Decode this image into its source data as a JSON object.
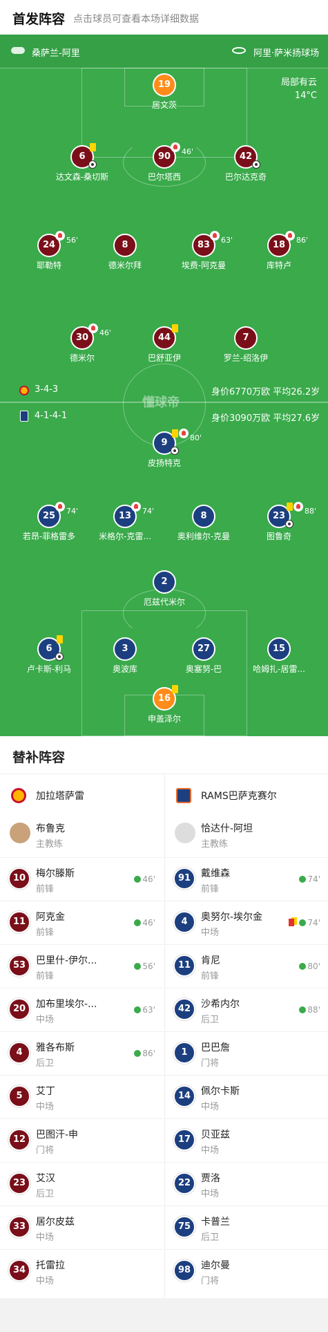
{
  "header": {
    "title": "首发阵容",
    "subtitle": "点击球员可查看本场详细数据"
  },
  "pitch": {
    "home_team_top": "桑萨兰-阿里",
    "venue": "阿里·萨米扬球场",
    "weather": "局部有云",
    "temperature": "14°C",
    "watermark": "懂球帝",
    "home_formation": "3-4-3",
    "home_value": "身价6770万欧 平均26.2岁",
    "away_formation": "4-1-4-1",
    "away_value": "身价3090万欧 平均27.6岁",
    "home_players": [
      {
        "num": "19",
        "name": "居文茨",
        "gk": true
      },
      {
        "num": "6",
        "name": "达文森-桑切斯"
      },
      {
        "num": "90",
        "name": "巴尔塔西",
        "sub": "46'"
      },
      {
        "num": "42",
        "name": "巴尔达克奇"
      },
      {
        "num": "24",
        "name": "耶勒特",
        "sub": "56'"
      },
      {
        "num": "8",
        "name": "德米尔拜"
      },
      {
        "num": "83",
        "name": "埃费-阿克曼",
        "sub": "63'"
      },
      {
        "num": "18",
        "name": "库特卢",
        "sub": "86'"
      },
      {
        "num": "30",
        "name": "德米尔",
        "sub": "46'"
      },
      {
        "num": "44",
        "name": "巴舒亚伊"
      },
      {
        "num": "7",
        "name": "罗兰-绍洛伊"
      }
    ],
    "away_players": [
      {
        "num": "9",
        "name": "皮扬特克",
        "sub": "80'"
      },
      {
        "num": "25",
        "name": "若昂-菲格雷多",
        "sub": "74'"
      },
      {
        "num": "13",
        "name": "米格尔-克雷...",
        "sub": "74'"
      },
      {
        "num": "8",
        "name": "奥利维尔-克曼"
      },
      {
        "num": "23",
        "name": "图鲁奇",
        "sub": "88'"
      },
      {
        "num": "2",
        "name": "厄兹代米尔"
      },
      {
        "num": "6",
        "name": "卢卡斯-利马"
      },
      {
        "num": "3",
        "name": "奥波库"
      },
      {
        "num": "27",
        "name": "奥塞努-巴"
      },
      {
        "num": "15",
        "name": "哈姆扎-居雷..."
      },
      {
        "num": "16",
        "name": "申盖泽尔",
        "gk": true
      }
    ]
  },
  "subs": {
    "title": "替补阵容",
    "home": {
      "team": "加拉塔萨雷",
      "coach": "布鲁克",
      "coach_role": "主教练",
      "players": [
        {
          "num": "10",
          "name": "梅尔滕斯",
          "pos": "前锋",
          "in": "46'"
        },
        {
          "num": "11",
          "name": "阿克金",
          "pos": "前锋",
          "in": "46'"
        },
        {
          "num": "53",
          "name": "巴里什-伊尔...",
          "pos": "前锋",
          "in": "56'"
        },
        {
          "num": "20",
          "name": "加布里埃尔-...",
          "pos": "中场",
          "in": "63'"
        },
        {
          "num": "4",
          "name": "雅各布斯",
          "pos": "后卫",
          "in": "86'"
        },
        {
          "num": "5",
          "name": "艾丁",
          "pos": "中场",
          "in": ""
        },
        {
          "num": "12",
          "name": "巴图汗-申",
          "pos": "门将",
          "in": ""
        },
        {
          "num": "23",
          "name": "艾汉",
          "pos": "后卫",
          "in": ""
        },
        {
          "num": "33",
          "name": "居尔皮兹",
          "pos": "中场",
          "in": ""
        },
        {
          "num": "34",
          "name": "托雷拉",
          "pos": "中场",
          "in": ""
        }
      ]
    },
    "away": {
      "team": "RAMS巴萨克赛尔",
      "coach": "恰达什-阿坦",
      "coach_role": "主教练",
      "players": [
        {
          "num": "91",
          "name": "戴维森",
          "pos": "前锋",
          "in": "74'"
        },
        {
          "num": "4",
          "name": "奥努尔-埃尔金",
          "pos": "中场",
          "in": "74'"
        },
        {
          "num": "11",
          "name": "肯尼",
          "pos": "前锋",
          "in": "80'"
        },
        {
          "num": "42",
          "name": "沙希内尔",
          "pos": "后卫",
          "in": "88'"
        },
        {
          "num": "1",
          "name": "巴巴詹",
          "pos": "门将",
          "in": ""
        },
        {
          "num": "14",
          "name": "佩尔卡斯",
          "pos": "中场",
          "in": ""
        },
        {
          "num": "17",
          "name": "贝亚兹",
          "pos": "中场",
          "in": ""
        },
        {
          "num": "22",
          "name": "贾洛",
          "pos": "中场",
          "in": ""
        },
        {
          "num": "75",
          "name": "卡普兰",
          "pos": "后卫",
          "in": ""
        },
        {
          "num": "98",
          "name": "迪尔曼",
          "pos": "门将",
          "in": ""
        }
      ]
    }
  }
}
